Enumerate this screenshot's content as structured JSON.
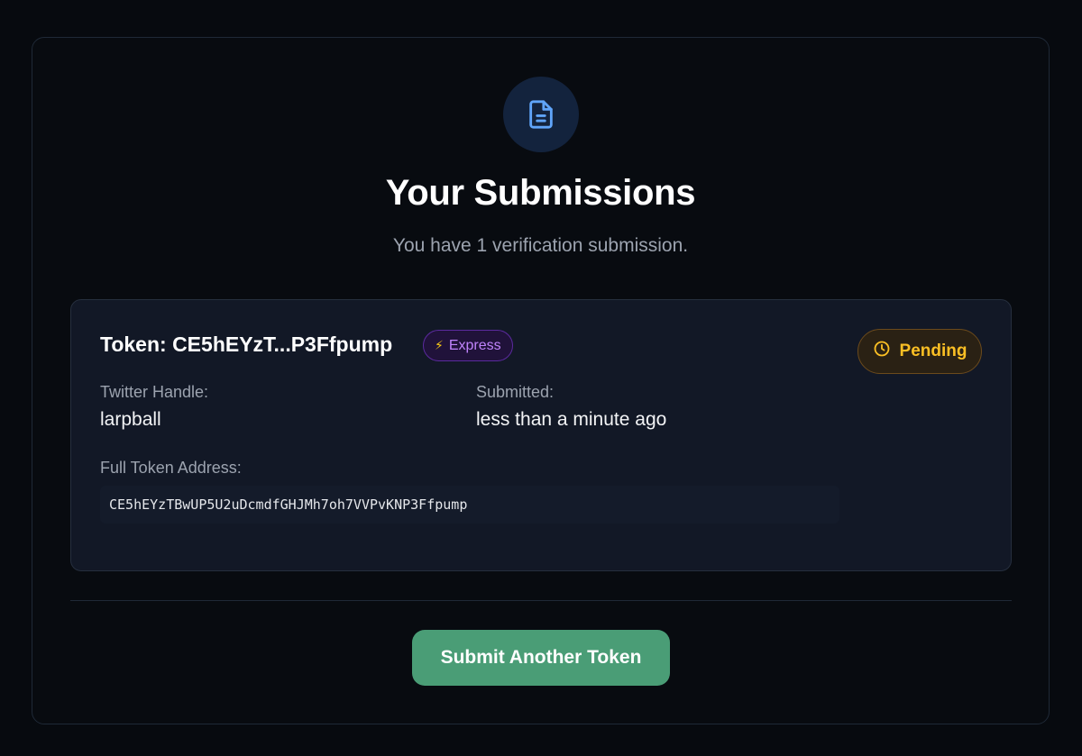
{
  "header": {
    "icon": "document-icon",
    "title": "Your Submissions",
    "subtitle": "You have 1 verification submission."
  },
  "submission": {
    "token_label": "Token: CE5hEYzT...P3Ffpump",
    "badge": {
      "icon": "lightning-icon",
      "label": "Express",
      "color": "#c084fc"
    },
    "status": {
      "icon": "clock-icon",
      "label": "Pending",
      "color": "#fbbf24"
    },
    "twitter_label": "Twitter Handle:",
    "twitter_value": "larpball",
    "submitted_label": "Submitted:",
    "submitted_value": "less than a minute ago",
    "address_label": "Full Token Address:",
    "address_value": "CE5hEYzTBwUP5U2uDcmdfGHJMh7oh7VVPvKNP3Ffpump"
  },
  "actions": {
    "submit_another_label": "Submit Another Token",
    "accent_color": "#4a9d76"
  }
}
